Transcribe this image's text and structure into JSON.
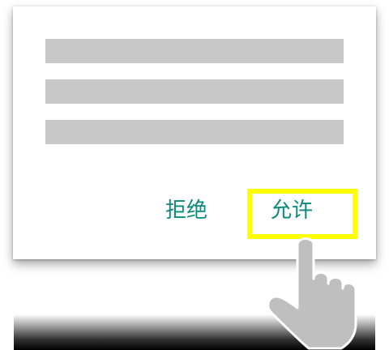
{
  "dialog": {
    "deny_label": "拒绝",
    "allow_label": "允许"
  },
  "colors": {
    "button_text": "#0a8a7a",
    "highlight": "#ffff00",
    "placeholder": "#c8c8c8",
    "hand": "#bfbfbf"
  },
  "icons": {
    "pointer": "tap-hand-icon"
  }
}
